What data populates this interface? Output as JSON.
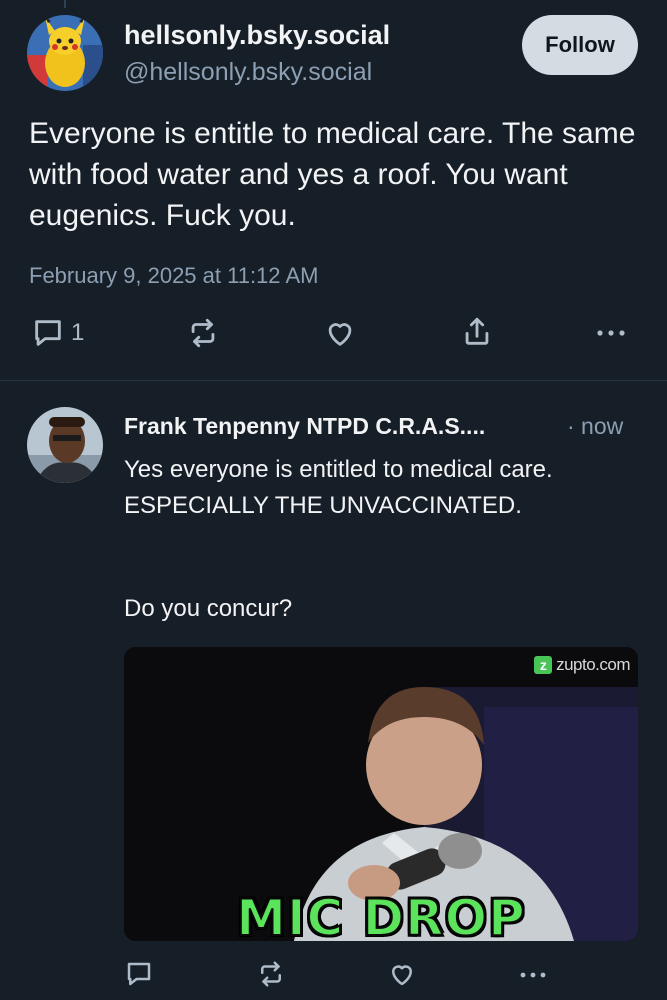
{
  "post": {
    "author_name": "hellsonly.bsky.social",
    "author_handle": "@hellsonly.bsky.social",
    "follow_label": "Follow",
    "text": "Everyone is entitle to medical care. The same with food water and yes a roof. You want eugenics. Fuck you.",
    "timestamp": "February 9, 2025 at 11:12 AM",
    "reply_count": "1"
  },
  "reply": {
    "author_name": "Frank Tenpenny NTPD C.R.A.S....",
    "time": "· now",
    "text": "Yes everyone is entitled to medical care. ESPECIALLY THE UNVACCINATED.",
    "question": "Do you concur?",
    "gif": {
      "watermark": "zupto.com",
      "caption": "MIC DROP"
    }
  },
  "icons": [
    "reply-icon",
    "repost-icon",
    "like-icon",
    "share-icon",
    "more-icon"
  ],
  "colors": {
    "background": "#161e27",
    "muted_text": "#8d9fb2",
    "follow_button": "#d4dbe2"
  }
}
